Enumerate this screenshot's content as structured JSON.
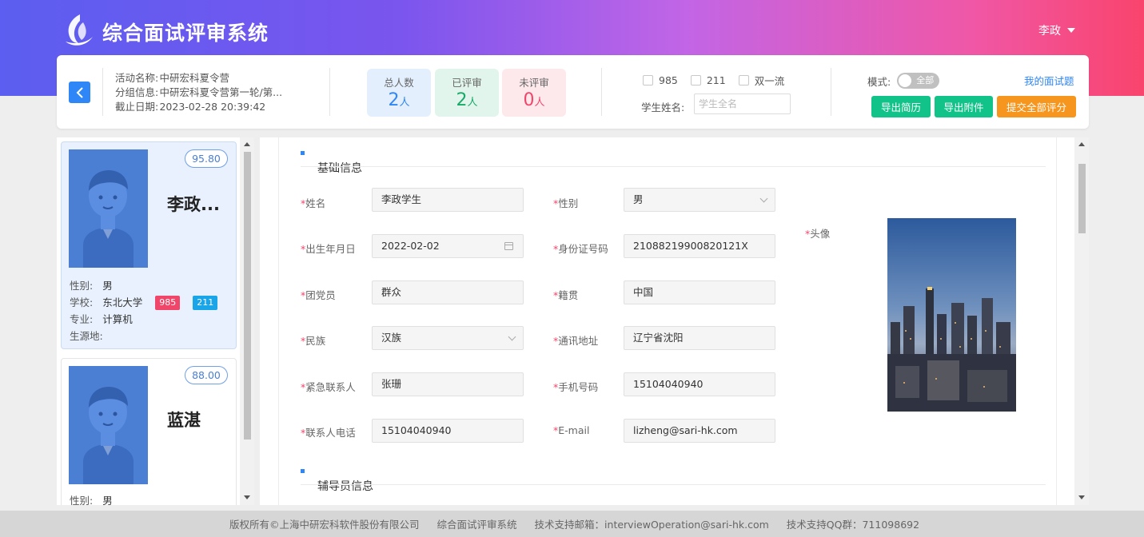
{
  "header": {
    "app_title": "综合面试评审系统",
    "user_name": "李政",
    "colors": {
      "gradient_start": "#5b5ef0",
      "gradient_end": "#f9446d"
    }
  },
  "activity": {
    "name_label": "活动名称:",
    "name_value": "中研宏科夏令营",
    "group_label": "分组信息:",
    "group_value": "中研宏科夏令营第一轮/第...",
    "deadline_label": "截止日期:",
    "deadline_value": "2023-02-28 20:39:42"
  },
  "stats": {
    "unit": "人",
    "total": {
      "label": "总人数",
      "value": "2"
    },
    "reviewed": {
      "label": "已评审",
      "value": "2"
    },
    "pending": {
      "label": "未评审",
      "value": "0"
    }
  },
  "filters": {
    "checkboxes": [
      "985",
      "211",
      "双一流"
    ],
    "student_name_label": "学生姓名:",
    "student_name_placeholder": "学生全名",
    "mode_label": "模式:",
    "mode_value": "全部",
    "my_interview_link": "我的面试题"
  },
  "actions": {
    "export_resume": "导出简历",
    "export_attachment": "导出附件",
    "submit_all": "提交全部评分",
    "colors": {
      "green": "#12c389",
      "orange": "#f7961e"
    }
  },
  "students": [
    {
      "score": "95.80",
      "name": "李政...",
      "gender_label": "性别:",
      "gender": "男",
      "school_label": "学校:",
      "school": "东北大学",
      "tags": [
        "985",
        "211"
      ],
      "major_label": "专业:",
      "major": "计算机",
      "origin_label": "生源地:",
      "origin": ""
    },
    {
      "score": "88.00",
      "name": "蓝湛",
      "gender_label": "性别:",
      "gender": "男"
    }
  ],
  "form": {
    "section_basic": "基础信息",
    "section_counselor": "辅导员信息",
    "name_label": "姓名",
    "name": "李政学生",
    "gender_label": "性别",
    "gender": "男",
    "birth_label": "出生年月日",
    "birth": "2022-02-02",
    "id_label": "身份证号码",
    "id_number": "21088219900820121X",
    "party_label": "团党员",
    "party": "群众",
    "native_label": "籍贯",
    "native": "中国",
    "ethnic_label": "民族",
    "ethnic": "汉族",
    "address_label": "通讯地址",
    "address": "辽宁省沈阳",
    "emergency_label": "紧急联系人",
    "emergency": "张珊",
    "mobile_label": "手机号码",
    "mobile": "15104040940",
    "contact_phone_label": "联系人电话",
    "contact_phone": "15104040940",
    "email_label": "E-mail",
    "email": "lizheng@sari-hk.com",
    "photo_label": "头像"
  },
  "footer": {
    "copyright": "版权所有©上海中研宏科软件股份有限公司",
    "system": "综合面试评审系统",
    "email_label": "技术支持邮箱：",
    "email": "interviewOperation@sari-hk.com",
    "qq_label": "技术支持QQ群：",
    "qq": "711098692"
  }
}
